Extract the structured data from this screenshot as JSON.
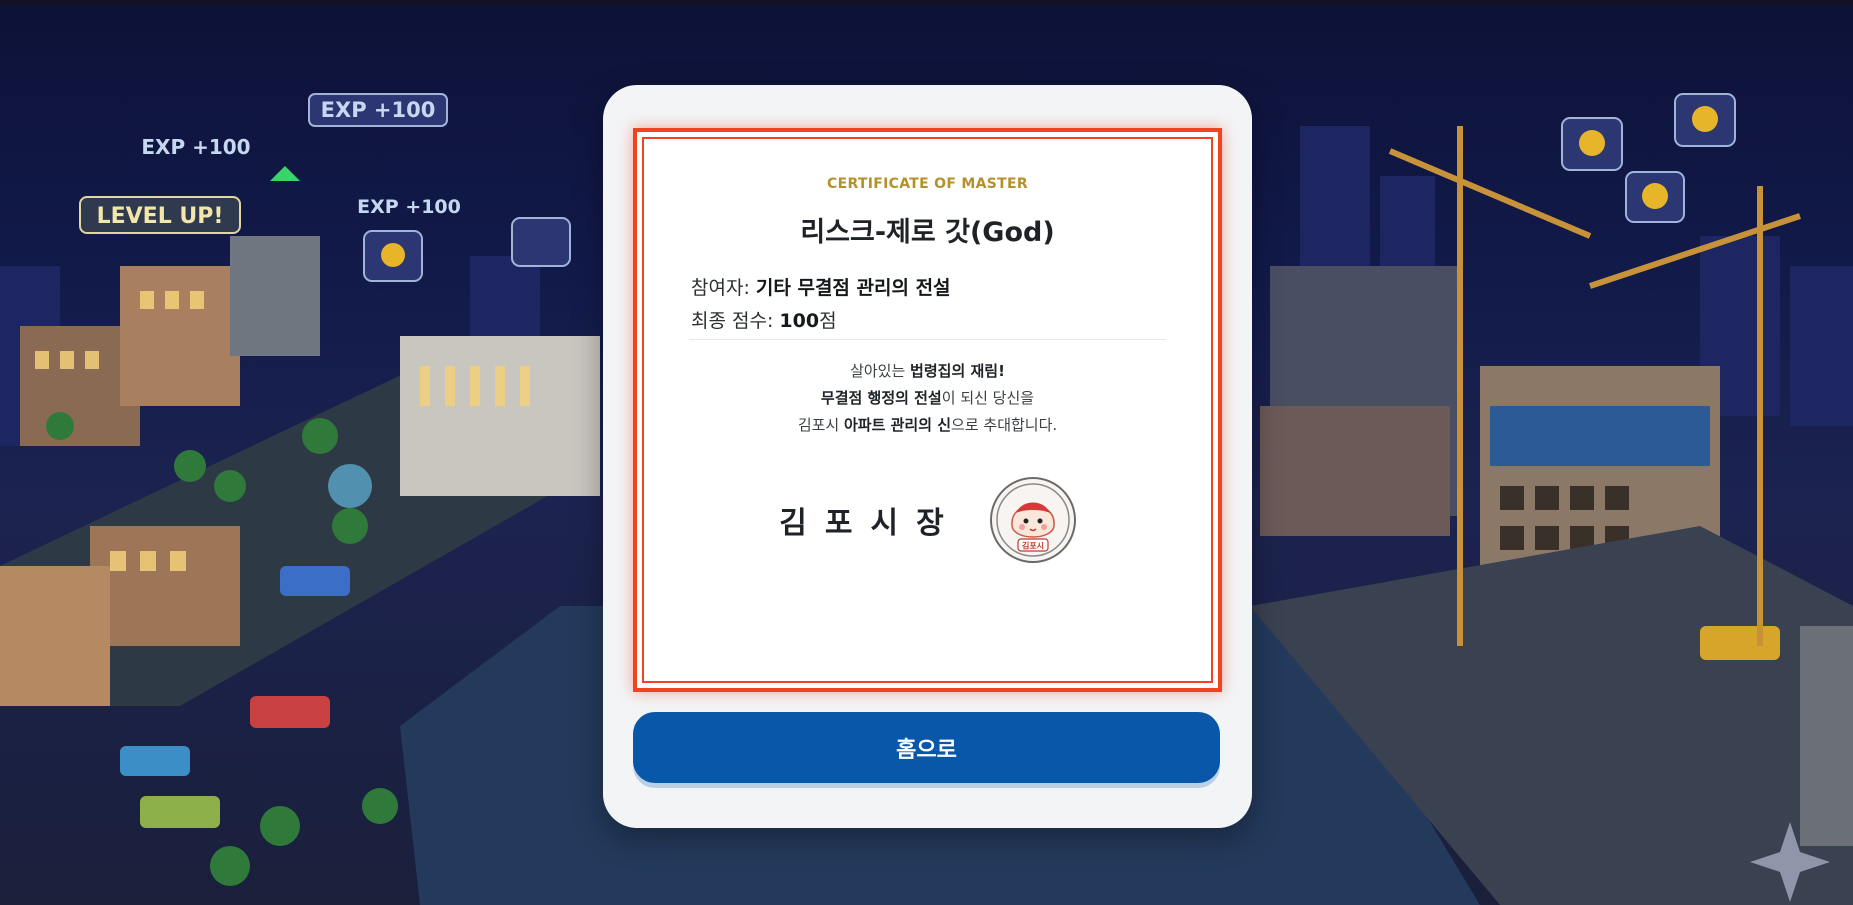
{
  "background": {
    "popups": {
      "exp_1": "EXP +100",
      "exp_2": "EXP +100",
      "exp_3": "EXP +100",
      "level_up": "LEVEL UP!"
    }
  },
  "certificate": {
    "eyebrow": "CERTIFICATE OF MASTER",
    "title": "리스크-제로 갓(God)",
    "participant_label": "참여자: ",
    "participant_value": "기타 무결점 관리의 전설",
    "score_label": "최종 점수: ",
    "score_value": "100",
    "score_unit": "점",
    "message": {
      "line1_pre": "살아있는 ",
      "line1_bold": "법령집의 재림!",
      "line2_bold": "무결점 행정의 전설",
      "line2_post": "이 되신 당신을",
      "line3_pre": "김포시 ",
      "line3_bold": "아파트 관리의 신",
      "line3_post": "으로 추대합니다."
    },
    "signature": "김포시장",
    "seal_text": "김포시"
  },
  "actions": {
    "home_label": "홈으로"
  },
  "colors": {
    "accent_gold": "#b8902a",
    "border_orange": "#f0441f",
    "button_blue": "#0857a8"
  }
}
